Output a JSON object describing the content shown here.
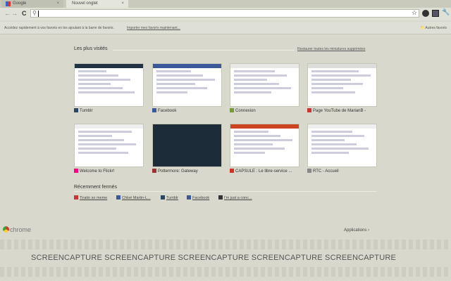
{
  "tabs": [
    {
      "label": "Google"
    },
    {
      "label": "Nouvel onglet"
    }
  ],
  "omnibox": {
    "value": ""
  },
  "bookmarks_bar": {
    "message": "Accédez rapidement à vos favoris en les ajoutant à la barre de favoris.",
    "import_link": "Importer mes favoris maintenant...",
    "other": "Autres favoris"
  },
  "most_visited": {
    "title": "Les plus visités",
    "restore": "Restaurer toutes les miniatures supprimées",
    "items": [
      {
        "label": "Tumblr",
        "color": "#2c4762"
      },
      {
        "label": "Facebook",
        "color": "#3b5998"
      },
      {
        "label": "Connexion",
        "color": "#7a9a3a"
      },
      {
        "label": "Page YouTube de MarianB -",
        "color": "#cc3333"
      },
      {
        "label": "Welcome to Flickr!",
        "color": "#ff0084"
      },
      {
        "label": "Pottermore: Gateway",
        "color": "#993333"
      },
      {
        "label": "CAPSULE : Le libre-service ...",
        "color": "#cc3322"
      },
      {
        "label": "RTC - Accueil",
        "color": "#888888"
      }
    ]
  },
  "recently_closed": {
    "title": "Récemment fermés",
    "items": [
      {
        "label": "Tiraito so meme"
      },
      {
        "label": "Chloé Martin-L..."
      },
      {
        "label": "Tumblr"
      },
      {
        "label": "Facebook"
      },
      {
        "label": "I'm just a conc..."
      }
    ]
  },
  "footer": {
    "brand": "chrome",
    "apps": "Applications"
  },
  "watermark": "SCREENCAPTURE SCREENCAPTURE SCREENCAPTURE SCREENCAPTURE SCREENCAPTURE"
}
